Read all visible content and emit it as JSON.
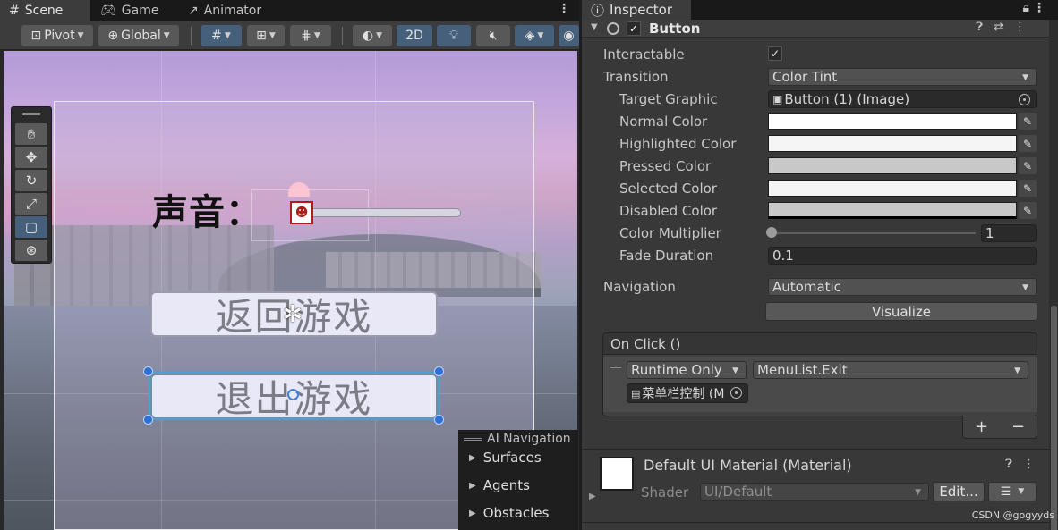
{
  "scene_tabs": [
    {
      "label": "Scene",
      "icon": "grid-icon"
    },
    {
      "label": "Game",
      "icon": "gamepad-icon"
    },
    {
      "label": "Animator",
      "icon": "animator-icon"
    }
  ],
  "toolbar": {
    "pivot_label": "Pivot",
    "global_label": "Global",
    "mode_2d_label": "2D"
  },
  "scene": {
    "sound_label": "声音：",
    "resume_button_label": "返回游戏",
    "exit_button_label": "退出游戏"
  },
  "ai_navigation": {
    "title": "AI Navigation",
    "items": [
      "Surfaces",
      "Agents",
      "Obstacles"
    ]
  },
  "inspector": {
    "tab_label": "Inspector",
    "component_title": "Button",
    "fields": {
      "interactable_label": "Interactable",
      "transition_label": "Transition",
      "transition_value": "Color Tint",
      "target_graphic_label": "Target Graphic",
      "target_graphic_value": "Button (1) (Image)",
      "normal_color_label": "Normal Color",
      "highlighted_color_label": "Highlighted Color",
      "pressed_color_label": "Pressed Color",
      "selected_color_label": "Selected Color",
      "disabled_color_label": "Disabled Color",
      "color_multiplier_label": "Color Multiplier",
      "color_multiplier_value": "1",
      "fade_duration_label": "Fade Duration",
      "fade_duration_value": "0.1",
      "navigation_label": "Navigation",
      "navigation_value": "Automatic",
      "visualize_label": "Visualize"
    },
    "onclick": {
      "header": "On Click ()",
      "runtime_value": "Runtime Only",
      "function_value": "MenuList.Exit",
      "object_value": "菜单栏控制 (M",
      "plus": "+",
      "minus": "−"
    },
    "material": {
      "title": "Default UI Material (Material)",
      "shader_label": "Shader",
      "shader_value": "UI/Default",
      "edit_label": "Edit..."
    }
  },
  "colors": {
    "normal": "#ffffff",
    "highlighted": "#f5f5f5",
    "pressed": "#c8c8c8",
    "selected": "#f5f5f5",
    "disabled": "#c8c8c8",
    "selection_blue": "#46607c"
  },
  "watermark": "CSDN @gogyyds"
}
